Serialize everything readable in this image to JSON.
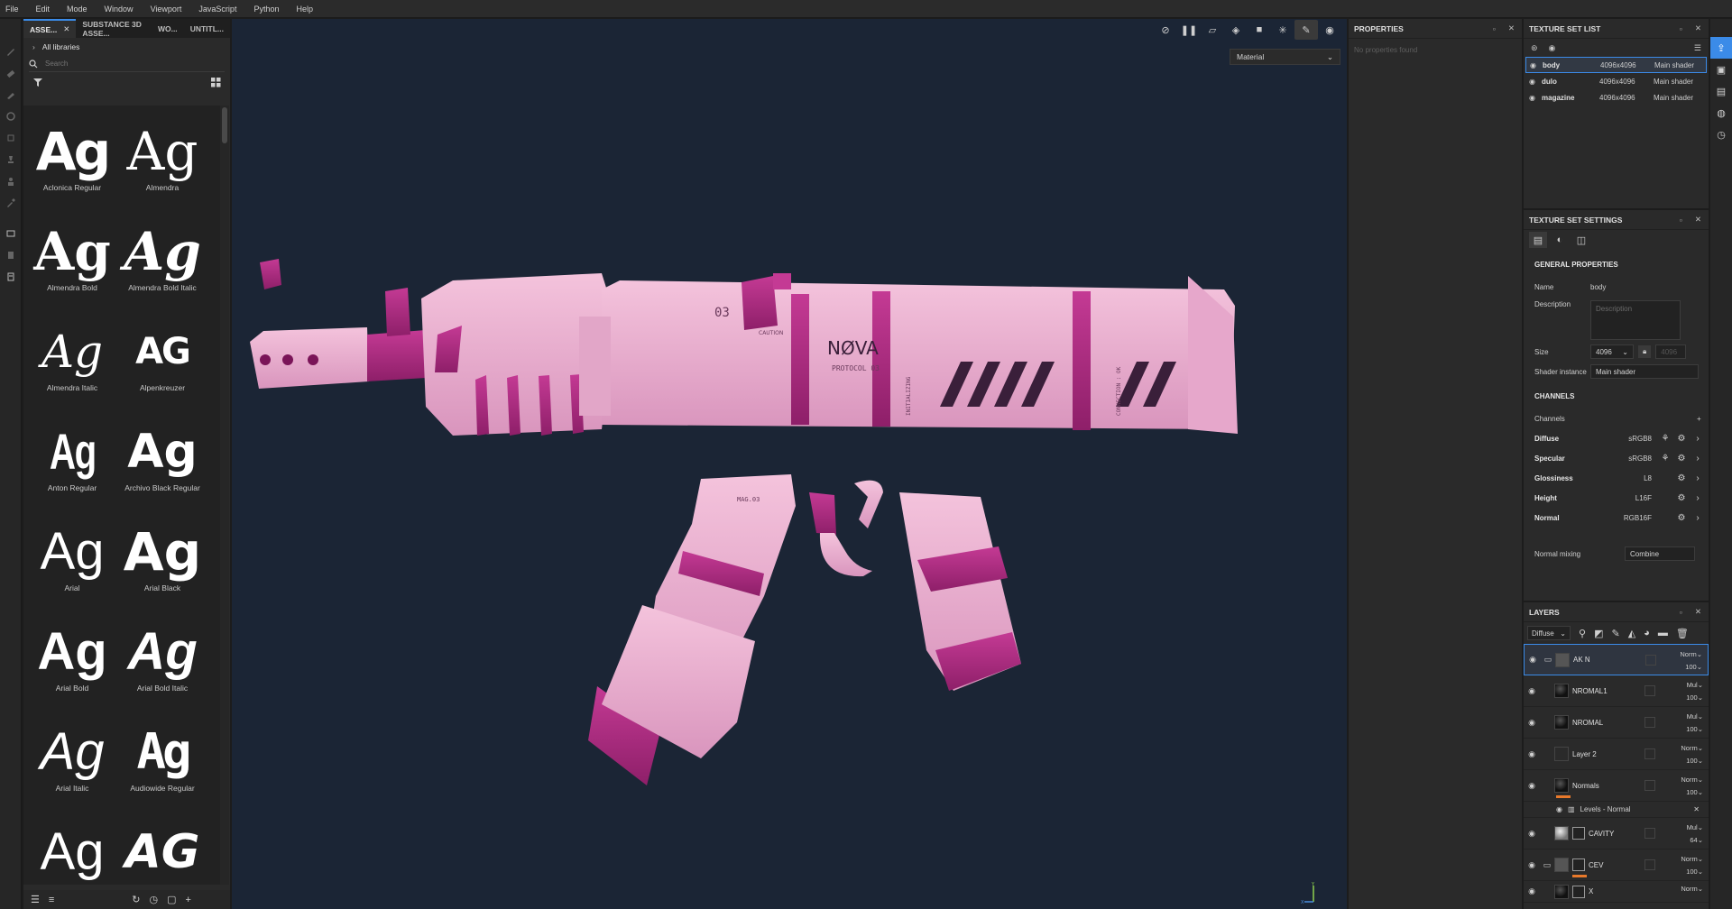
{
  "menu": [
    "File",
    "Edit",
    "Mode",
    "Window",
    "Viewport",
    "JavaScript",
    "Python",
    "Help"
  ],
  "assets": {
    "tabs": [
      {
        "label": "ASSE...",
        "close": "✕"
      },
      {
        "label": "SUBSTANCE 3D ASSE..."
      },
      {
        "label": "WO..."
      },
      {
        "label": "UNTITL..."
      }
    ],
    "libraries_label": "All libraries",
    "search_placeholder": "Search",
    "fonts": [
      {
        "sample": "Ag",
        "name": "Aclonica Regular"
      },
      {
        "sample": "Ag",
        "name": "Almendra"
      },
      {
        "sample": "Ag",
        "name": "Almendra Bold"
      },
      {
        "sample": "Ag",
        "name": "Almendra Bold Italic"
      },
      {
        "sample": "Ag",
        "name": "Almendra Italic"
      },
      {
        "sample": "AG",
        "name": "Alpenkreuzer"
      },
      {
        "sample": "Ag",
        "name": "Anton Regular"
      },
      {
        "sample": "Ag",
        "name": "Archivo Black Regular"
      },
      {
        "sample": "Ag",
        "name": "Arial"
      },
      {
        "sample": "Ag",
        "name": "Arial Black"
      },
      {
        "sample": "Ag",
        "name": "Arial Bold"
      },
      {
        "sample": "Ag",
        "name": "Arial Bold Italic"
      },
      {
        "sample": "Ag",
        "name": "Arial Italic"
      },
      {
        "sample": "Ag",
        "name": "Audiowide Regular"
      },
      {
        "sample": "Ag",
        "name": ""
      },
      {
        "sample": "AG",
        "name": ""
      }
    ]
  },
  "viewport": {
    "material_dropdown": "Material",
    "gun_text": {
      "brand": "NØVA",
      "protocol": "PROTOCOL 03",
      "number": "03",
      "caution": "CAUTION",
      "mag": "MAG.03",
      "initializing": "INITIALIZING",
      "connection": "CONNECTION : OK"
    },
    "axis": {
      "y": "Y",
      "x": "X"
    }
  },
  "properties": {
    "title": "PROPERTIES",
    "empty": "No properties found"
  },
  "texture_set_list": {
    "title": "TEXTURE SET LIST",
    "rows": [
      {
        "name": "body",
        "size": "4096x4096",
        "shader": "Main shader"
      },
      {
        "name": "dulo",
        "size": "4096x4096",
        "shader": "Main shader"
      },
      {
        "name": "magazine",
        "size": "4096x4096",
        "shader": "Main shader"
      }
    ]
  },
  "texture_set_settings": {
    "title": "TEXTURE SET SETTINGS",
    "general_title": "GENERAL PROPERTIES",
    "name_label": "Name",
    "name_value": "body",
    "description_label": "Description",
    "description_placeholder": "Description",
    "size_label": "Size",
    "size_value": "4096",
    "size_linked": "4096",
    "shader_label": "Shader instance",
    "shader_value": "Main shader",
    "channels_title": "CHANNELS",
    "channels_label": "Channels",
    "channels": [
      {
        "name": "Diffuse",
        "format": "sRGB8"
      },
      {
        "name": "Specular",
        "format": "sRGB8"
      },
      {
        "name": "Glossiness",
        "format": "L8"
      },
      {
        "name": "Height",
        "format": "L16F"
      },
      {
        "name": "Normal",
        "format": "RGB16F"
      }
    ],
    "normal_mixing_label": "Normal mixing",
    "normal_mixing_value": "Combine"
  },
  "layers": {
    "title": "LAYERS",
    "channel_select": "Diffuse",
    "rows": [
      {
        "name": "AK N",
        "blend": "Norm",
        "opacity": "100"
      },
      {
        "name": "NROMAL1",
        "blend": "Mul",
        "opacity": "100"
      },
      {
        "name": "NROMAL",
        "blend": "Mul",
        "opacity": "100"
      },
      {
        "name": "Layer 2",
        "blend": "Norm",
        "opacity": "100"
      },
      {
        "name": "Normals",
        "blend": "Norm",
        "opacity": "100"
      }
    ],
    "filter_row": "Levels - Normal",
    "rows2": [
      {
        "name": "CAVITY",
        "blend": "Mul",
        "opacity": "64"
      },
      {
        "name": "CEV",
        "blend": "Norm",
        "opacity": "100"
      },
      {
        "name": "X",
        "blend": "Norm",
        "opacity": ""
      }
    ]
  }
}
